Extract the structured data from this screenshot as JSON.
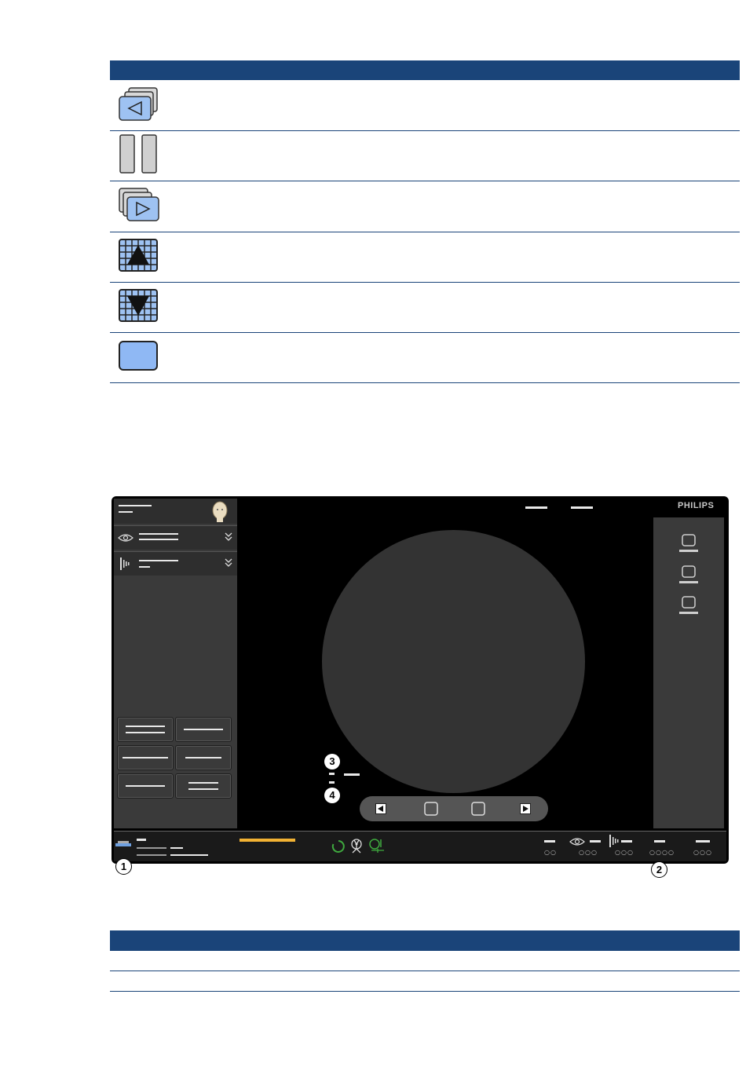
{
  "top_table": {
    "rows": [
      {
        "icon": "previous-series-icon"
      },
      {
        "icon": "pause-icon"
      },
      {
        "icon": "next-series-icon"
      },
      {
        "icon": "grid-up-icon"
      },
      {
        "icon": "grid-down-icon"
      },
      {
        "icon": "single-frame-icon"
      }
    ]
  },
  "screen": {
    "brand": "PHILIPS",
    "callouts": [
      "1",
      "2",
      "3",
      "4"
    ],
    "status_bar": {
      "dot_groups": [
        "○○",
        "○○○",
        "○○○",
        "○○○○",
        "○○○"
      ]
    }
  },
  "colors": {
    "header_blue": "#1a4479",
    "screen_bg": "#000000",
    "panel_gray": "#3a3a3a",
    "viewport_circle": "#333333",
    "accent_orange": "#f2b233",
    "accent_green": "#3faa3f"
  }
}
